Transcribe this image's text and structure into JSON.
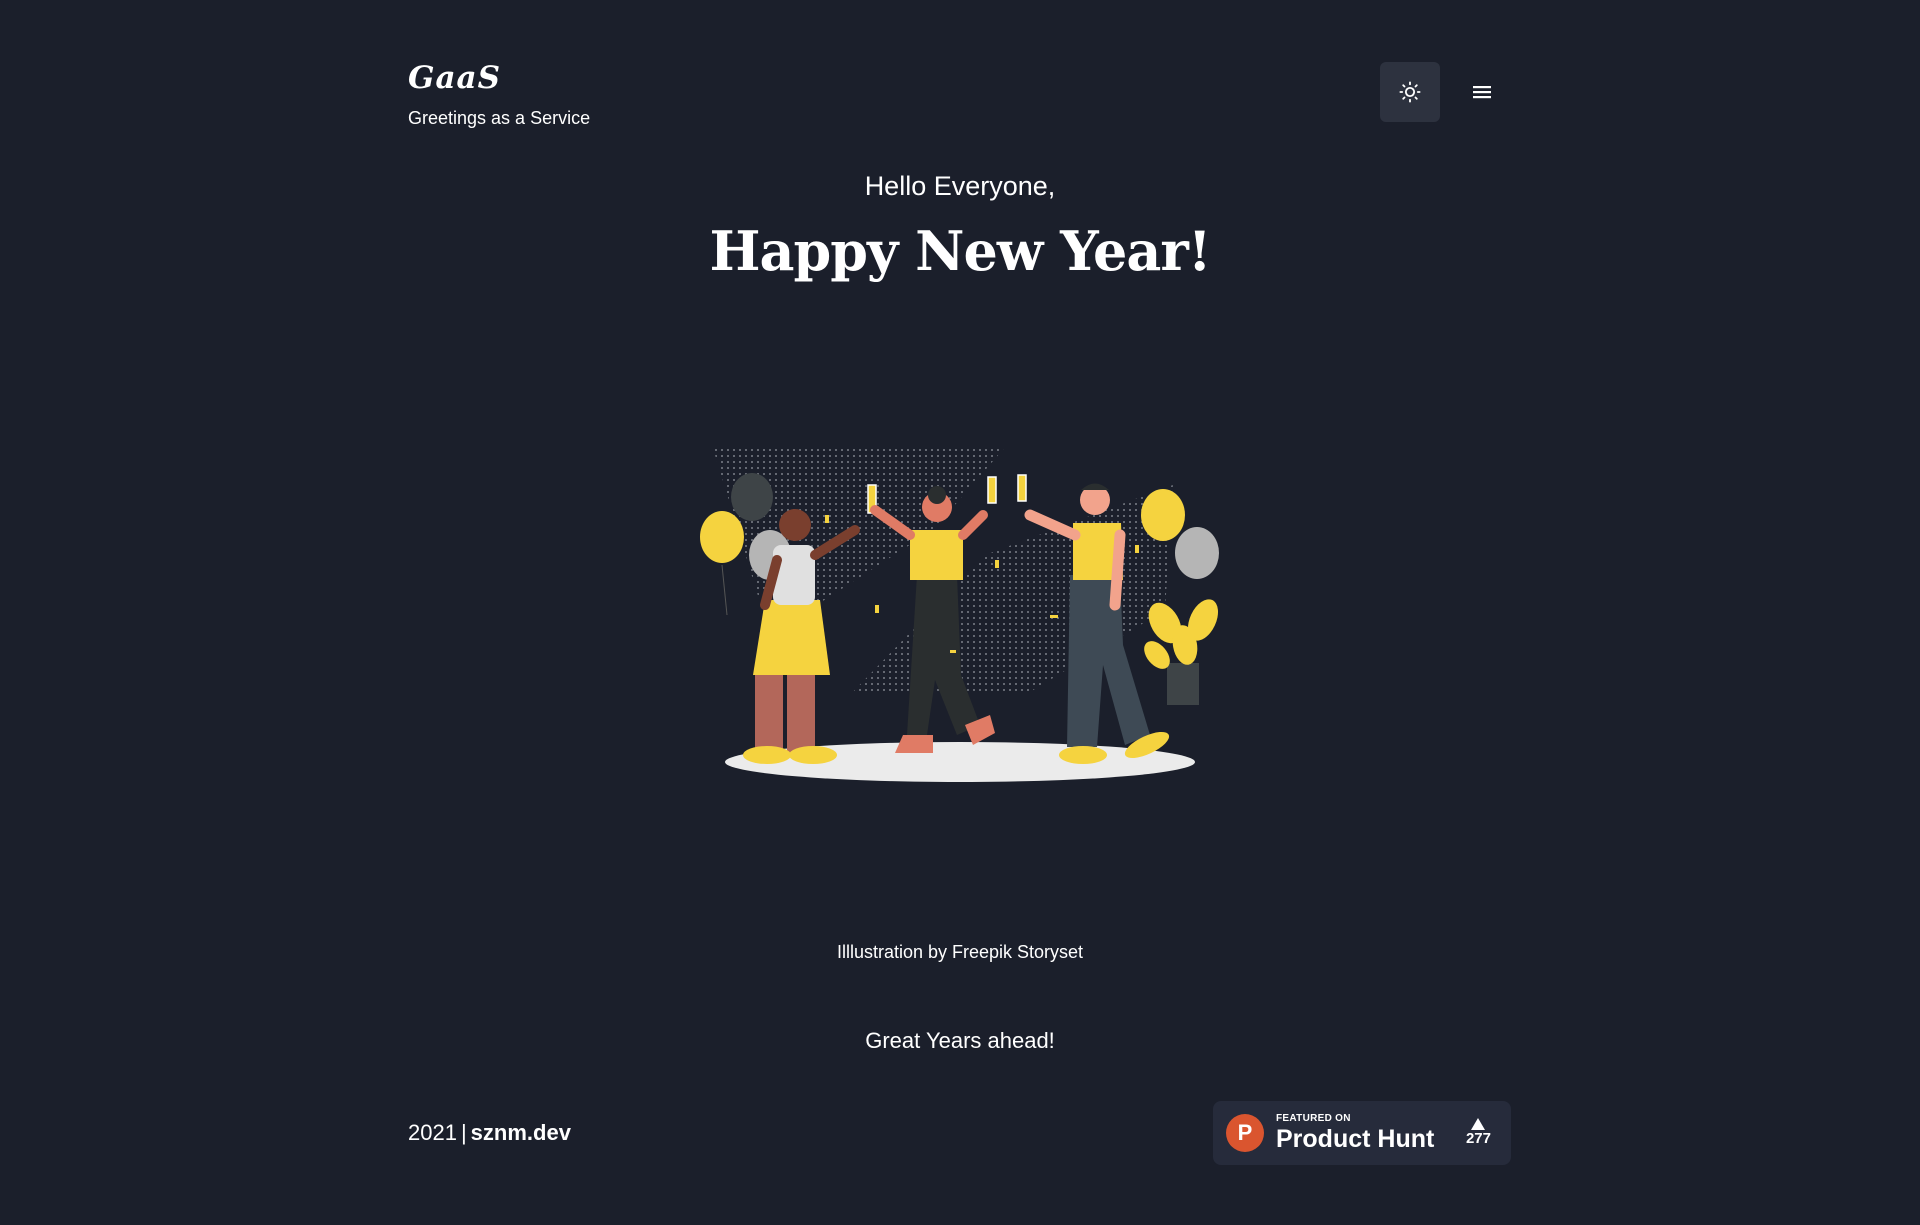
{
  "header": {
    "logo": "GaaS",
    "tagline": "Greetings as a Service",
    "theme_toggle_icon": "sun-icon",
    "menu_icon": "hamburger-menu-icon"
  },
  "main": {
    "greeting": "Hello Everyone,",
    "title": "Happy New Year!",
    "illustration_alt": "people-celebrating-new-year-illustration",
    "credit": "Illlustration by Freepik Storyset",
    "sub_greeting": "Great Years ahead!"
  },
  "footer": {
    "year": "2021",
    "separator": "|",
    "site": "sznm.dev"
  },
  "product_hunt": {
    "logo_letter": "P",
    "featured_label": "FEATURED ON",
    "name": "Product Hunt",
    "vote_icon": "upvote-triangle-icon",
    "votes": "277"
  },
  "colors": {
    "background": "#1b1f2b",
    "button_bg": "#2d323f",
    "badge_bg": "#262b3b",
    "product_hunt_orange": "#da552f",
    "accent_yellow": "#f5d33f"
  }
}
